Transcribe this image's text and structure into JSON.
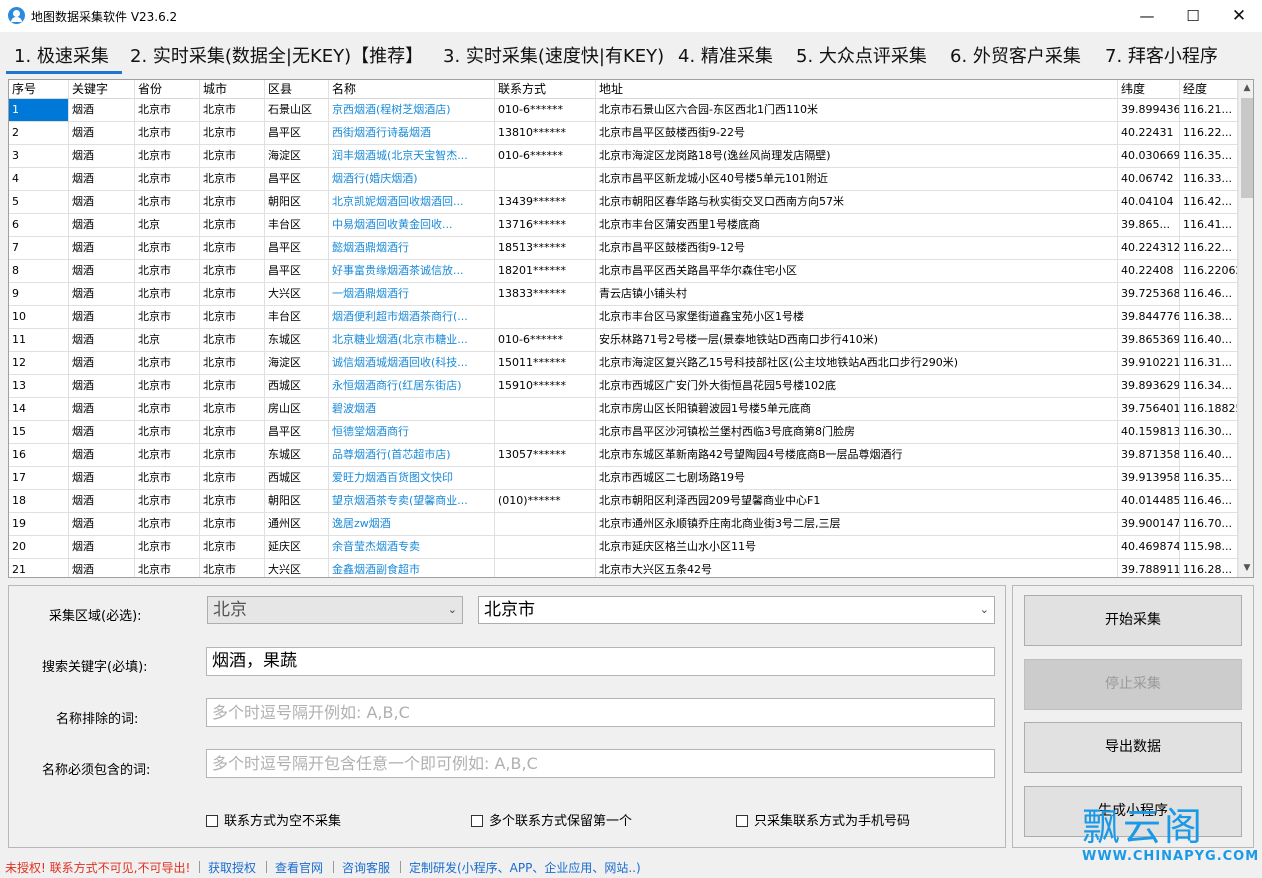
{
  "window": {
    "title": "地图数据采集软件 V23.6.2",
    "controls": {
      "minimize": "—",
      "maximize": "☐",
      "close": "✕"
    }
  },
  "tabs": [
    {
      "label": "1. 极速采集",
      "active": true
    },
    {
      "label": "2. 实时采集(数据全|无KEY)【推荐】"
    },
    {
      "label": "3. 实时采集(速度快|有KEY)"
    },
    {
      "label": "4. 精准采集"
    },
    {
      "label": "5. 大众点评采集"
    },
    {
      "label": "6. 外贸客户采集"
    },
    {
      "label": "7. 拜客小程序"
    }
  ],
  "table": {
    "columns": [
      "序号",
      "关键字",
      "省份",
      "城市",
      "区县",
      "名称",
      "联系方式",
      "地址",
      "纬度",
      "经度"
    ],
    "rows": [
      [
        "1",
        "烟酒",
        "北京市",
        "北京市",
        "石景山区",
        "京西烟酒(程树芝烟酒店)",
        "010-6******",
        "北京市石景山区六合园-东区西北1门西110米",
        "39.899436",
        "116.21..."
      ],
      [
        "2",
        "烟酒",
        "北京市",
        "北京市",
        "昌平区",
        "西街烟酒行诗磊烟酒",
        "13810******",
        "北京市昌平区鼓楼西街9-22号",
        "40.22431",
        "116.22..."
      ],
      [
        "3",
        "烟酒",
        "北京市",
        "北京市",
        "海淀区",
        "润丰烟酒城(北京天宝智杰...",
        "010-6******",
        "北京市海淀区龙岗路18号(逸丝风尚理发店隔壁)",
        "40.030669",
        "116.35..."
      ],
      [
        "4",
        "烟酒",
        "北京市",
        "北京市",
        "昌平区",
        "烟酒行(婚庆烟酒)",
        "",
        "北京市昌平区新龙城小区40号楼5单元101附近",
        "40.06742",
        "116.33..."
      ],
      [
        "5",
        "烟酒",
        "北京市",
        "北京市",
        "朝阳区",
        "北京凯妮烟酒回收烟酒回...",
        "13439******",
        "北京市朝阳区春华路与秋实街交叉口西南方向57米",
        "40.04104",
        "116.42..."
      ],
      [
        "6",
        "烟酒",
        "北京",
        "北京市",
        "丰台区",
        "中易烟酒回收黄金回收...",
        "13716******",
        "北京市丰台区蒲安西里1号楼底商",
        "39.865...",
        "116.41..."
      ],
      [
        "7",
        "烟酒",
        "北京市",
        "北京市",
        "昌平区",
        "懿烟酒鼎烟酒行",
        "18513******",
        "北京市昌平区鼓楼西街9-12号",
        "40.224312",
        "116.22..."
      ],
      [
        "8",
        "烟酒",
        "北京市",
        "北京市",
        "昌平区",
        "好事富贵缘烟酒茶诚信放...",
        "18201******",
        "北京市昌平区西关路昌平华尔森住宅小区",
        "40.22408",
        "116.22062"
      ],
      [
        "9",
        "烟酒",
        "北京市",
        "北京市",
        "大兴区",
        "一烟酒鼎烟酒行",
        "13833******",
        "青云店镇小铺头村",
        "39.725368",
        "116.46..."
      ],
      [
        "10",
        "烟酒",
        "北京市",
        "北京市",
        "丰台区",
        "烟酒便利超市烟酒茶商行(...",
        "",
        "北京市丰台区马家堡街道鑫宝苑小区1号楼",
        "39.844776",
        "116.38..."
      ],
      [
        "11",
        "烟酒",
        "北京",
        "北京市",
        "东城区",
        "北京糖业烟酒(北京市糖业...",
        "010-6******",
        "安乐林路71号2号楼一层(景泰地铁站D西南口步行410米)",
        "39.865369",
        "116.40..."
      ],
      [
        "12",
        "烟酒",
        "北京市",
        "北京市",
        "海淀区",
        "诚信烟酒城烟酒回收(科技...",
        "15011******",
        "北京市海淀区复兴路乙15号科技部社区(公主坟地铁站A西北口步行290米)",
        "39.910221",
        "116.31..."
      ],
      [
        "13",
        "烟酒",
        "北京市",
        "北京市",
        "西城区",
        "永恒烟酒商行(红居东街店)",
        "15910******",
        "北京市西城区广安门外大街恒昌花园5号楼102底",
        "39.893629",
        "116.34..."
      ],
      [
        "14",
        "烟酒",
        "北京市",
        "北京市",
        "房山区",
        "碧波烟酒",
        "",
        "北京市房山区长阳镇碧波园1号楼5单元底商",
        "39.756401",
        "116.18825"
      ],
      [
        "15",
        "烟酒",
        "北京市",
        "北京市",
        "昌平区",
        "恒德堂烟酒商行",
        "",
        "北京市昌平区沙河镇松兰堡村西临3号底商第8门脸房",
        "40.159813",
        "116.30..."
      ],
      [
        "16",
        "烟酒",
        "北京市",
        "北京市",
        "东城区",
        "品尊烟酒行(首芯超市店)",
        "13057******",
        "北京市东城区革新南路42号望陶园4号楼底商B一层品尊烟酒行",
        "39.871358",
        "116.40..."
      ],
      [
        "17",
        "烟酒",
        "北京市",
        "北京市",
        "西城区",
        "爱旺力烟酒百货图文快印",
        "",
        "北京市西城区二七剧场路19号",
        "39.913958",
        "116.35..."
      ],
      [
        "18",
        "烟酒",
        "北京市",
        "北京市",
        "朝阳区",
        "望京烟酒茶专卖(望馨商业...",
        "(010)******",
        "北京市朝阳区利泽西园209号望馨商业中心F1",
        "40.014485",
        "116.46..."
      ],
      [
        "19",
        "烟酒",
        "北京市",
        "北京市",
        "通州区",
        "逸居zw烟酒",
        "",
        "北京市通州区永顺镇乔庄南北商业街3号二层,三层",
        "39.900147",
        "116.70..."
      ],
      [
        "20",
        "烟酒",
        "北京市",
        "北京市",
        "延庆区",
        "余音莹杰烟酒专卖",
        "",
        "北京市延庆区格兰山水小区11号",
        "40.469874",
        "115.98..."
      ],
      [
        "21",
        "烟酒",
        "北京市",
        "北京市",
        "大兴区",
        "金鑫烟酒副食超市",
        "",
        "北京市大兴区五条42号",
        "39.788911",
        "116.28..."
      ]
    ]
  },
  "form": {
    "region_label": "采集区域(必选):",
    "region_province": "北京",
    "region_city": "北京市",
    "keyword_label": "搜索关键字(必填):",
    "keyword_value": "烟酒，果蔬",
    "exclude_label": "名称排除的词:",
    "exclude_placeholder": "多个时逗号隔开例如: A,B,C",
    "include_label": "名称必须包含的词:",
    "include_placeholder": "多个时逗号隔开包含任意一个即可例如: A,B,C",
    "options": [
      {
        "label": "联系方式为空不采集",
        "checked": false
      },
      {
        "label": "多个联系方式保留第一个",
        "checked": false
      },
      {
        "label": "只采集联系方式为手机号码",
        "checked": false
      }
    ]
  },
  "actions": {
    "start": "开始采集",
    "stop": "停止采集",
    "export": "导出数据",
    "miniprogram": "生成小程序"
  },
  "watermark": {
    "main": "飘云阁",
    "sub": "WWW.CHINAPYG.COM"
  },
  "status": {
    "warning": "未授权! 联系方式不可见,不可导出!",
    "links": [
      "获取授权",
      "查看官网",
      "咨询客服",
      "定制研发(小程序、APP、企业应用、网站..)"
    ]
  },
  "colors": {
    "accent": "#1e78d2",
    "link": "#1a8ad8",
    "selection": "#0078d7",
    "warning": "#e03020",
    "watermark": "#1a9ae6"
  }
}
